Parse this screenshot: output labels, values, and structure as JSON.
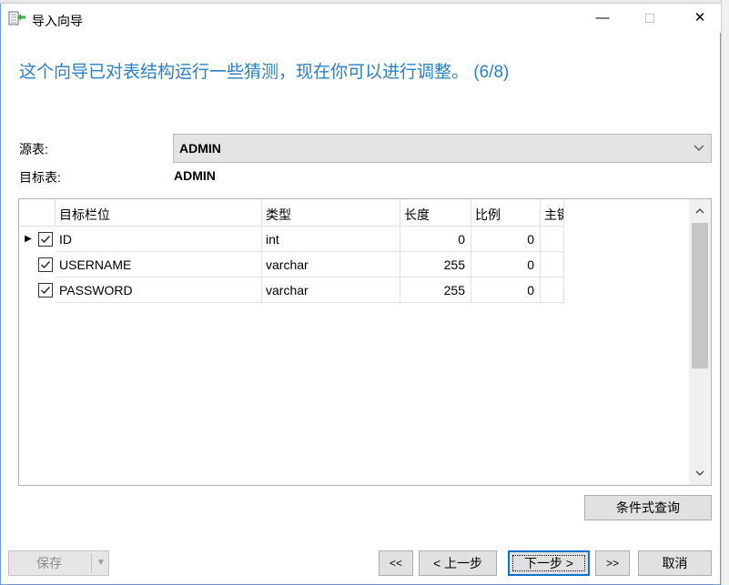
{
  "window": {
    "title": "导入向导",
    "minimize_glyph": "—",
    "close_glyph": "✕",
    "accent": "#2a80c9"
  },
  "heading": "这个向导已对表结构运行一些猜测，现在你可以进行调整。 (6/8)",
  "source": {
    "label": "源表:",
    "value": "ADMIN"
  },
  "target": {
    "label": "目标表:",
    "value": "ADMIN"
  },
  "grid": {
    "columns": [
      "目标栏位",
      "类型",
      "长度",
      "比例",
      "主键"
    ],
    "rows": [
      {
        "checked": true,
        "current": true,
        "field": "ID",
        "type": "int",
        "length": "0",
        "scale": "0"
      },
      {
        "checked": true,
        "current": false,
        "field": "USERNAME",
        "type": "varchar",
        "length": "255",
        "scale": "0"
      },
      {
        "checked": true,
        "current": false,
        "field": "PASSWORD",
        "type": "varchar",
        "length": "255",
        "scale": "0"
      }
    ]
  },
  "buttons": {
    "condition_query": "条件式查询",
    "save": "保存",
    "first": "<<",
    "prev": "< 上一步",
    "next": "下一步 >",
    "last": ">>",
    "cancel": "取消"
  },
  "icons": {
    "app": "import-wizard-icon",
    "combo_arrow": "chevron-down-icon",
    "row_pointer": "row-pointer-icon"
  }
}
